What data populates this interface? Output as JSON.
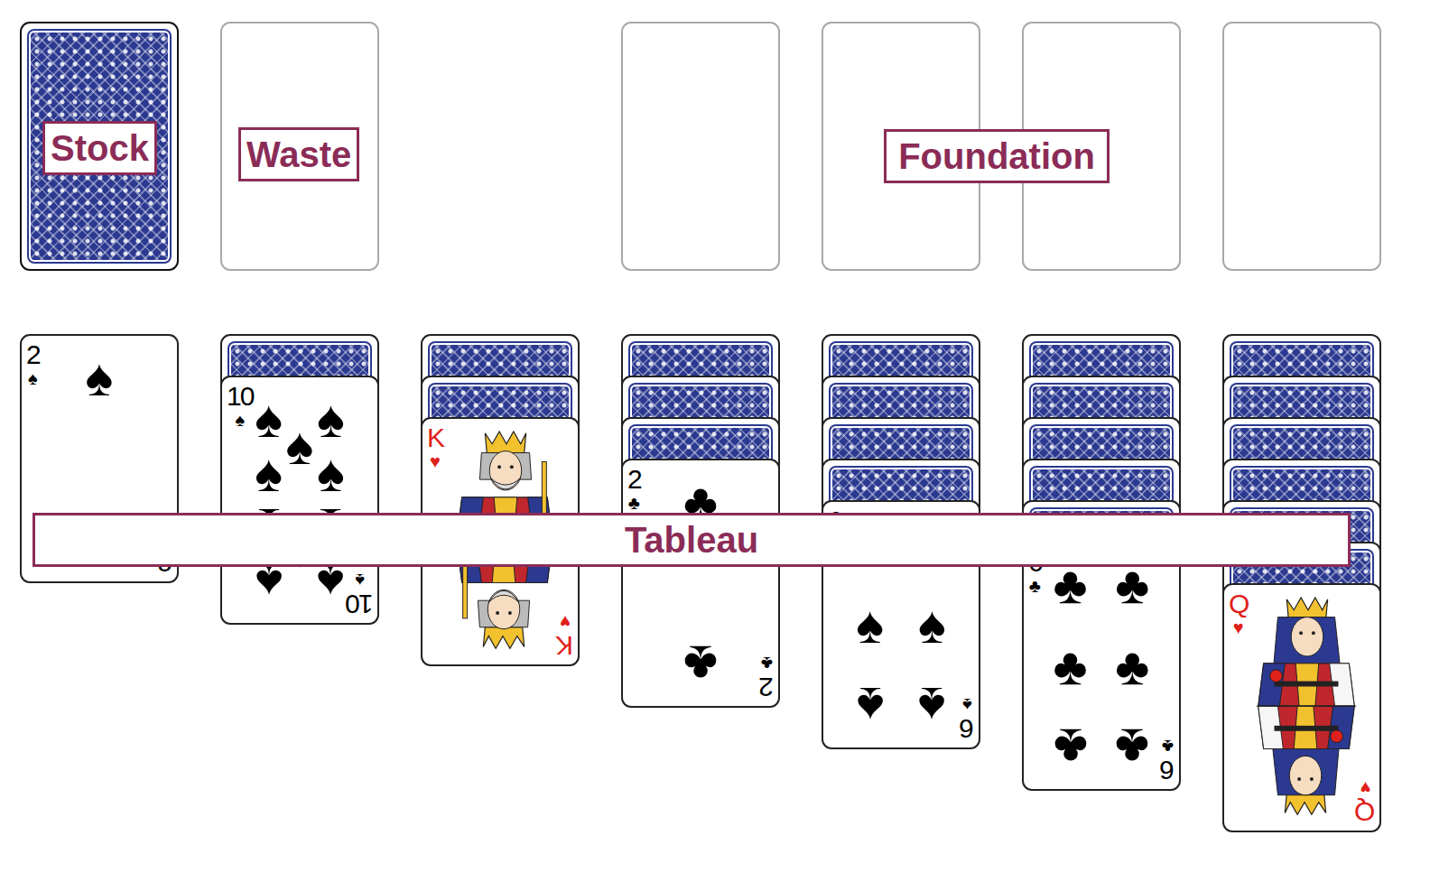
{
  "labels": {
    "stock": "Stock",
    "waste": "Waste",
    "foundation": "Foundation",
    "tableau": "Tableau"
  },
  "stock": {
    "face_up": false
  },
  "waste": {
    "empty": true
  },
  "foundations": [
    {
      "empty": true
    },
    {
      "empty": true
    },
    {
      "empty": true
    },
    {
      "empty": true
    }
  ],
  "tableau": [
    {
      "cards": [
        {
          "face_up": true,
          "rank": "2",
          "suit": "♠",
          "color": "#000000"
        }
      ]
    },
    {
      "cards": [
        {
          "face_up": false
        },
        {
          "face_up": true,
          "rank": "10",
          "suit": "♠",
          "color": "#000000"
        }
      ]
    },
    {
      "cards": [
        {
          "face_up": false
        },
        {
          "face_up": false
        },
        {
          "face_up": true,
          "rank": "K",
          "suit": "♥",
          "color": "#e0201b"
        }
      ]
    },
    {
      "cards": [
        {
          "face_up": false
        },
        {
          "face_up": false
        },
        {
          "face_up": false
        },
        {
          "face_up": true,
          "rank": "2",
          "suit": "♣",
          "color": "#000000"
        }
      ]
    },
    {
      "cards": [
        {
          "face_up": false
        },
        {
          "face_up": false
        },
        {
          "face_up": false
        },
        {
          "face_up": false
        },
        {
          "face_up": true,
          "rank": "6",
          "suit": "♠",
          "color": "#000000"
        }
      ]
    },
    {
      "cards": [
        {
          "face_up": false
        },
        {
          "face_up": false
        },
        {
          "face_up": false
        },
        {
          "face_up": false
        },
        {
          "face_up": false
        },
        {
          "face_up": true,
          "rank": "6",
          "suit": "♣",
          "color": "#000000"
        }
      ]
    },
    {
      "cards": [
        {
          "face_up": false
        },
        {
          "face_up": false
        },
        {
          "face_up": false
        },
        {
          "face_up": false
        },
        {
          "face_up": false
        },
        {
          "face_up": false
        },
        {
          "face_up": true,
          "rank": "Q",
          "suit": "♥",
          "color": "#e0201b"
        }
      ]
    }
  ]
}
